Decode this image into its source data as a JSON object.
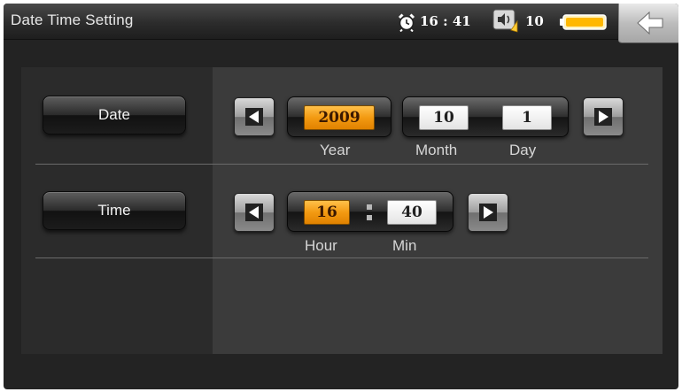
{
  "header": {
    "title": "Date  Time Setting",
    "clock": "16 : 41",
    "volume": "10",
    "alarm_icon": "alarm-clock-icon",
    "volume_icon": "speaker-icon",
    "battery_icon": "battery-icon",
    "back_icon": "back-arrow-icon"
  },
  "date_row": {
    "button_label": "Date",
    "year": "2009",
    "month": "10",
    "day": "1",
    "labels": {
      "year": "Year",
      "month": "Month",
      "day": "Day"
    }
  },
  "time_row": {
    "button_label": "Time",
    "hour": "16",
    "min": "40",
    "labels": {
      "hour": "Hour",
      "min": "Min"
    }
  },
  "colors": {
    "active": "#f39a12",
    "idle": "#ffffff",
    "background": "#232323"
  }
}
